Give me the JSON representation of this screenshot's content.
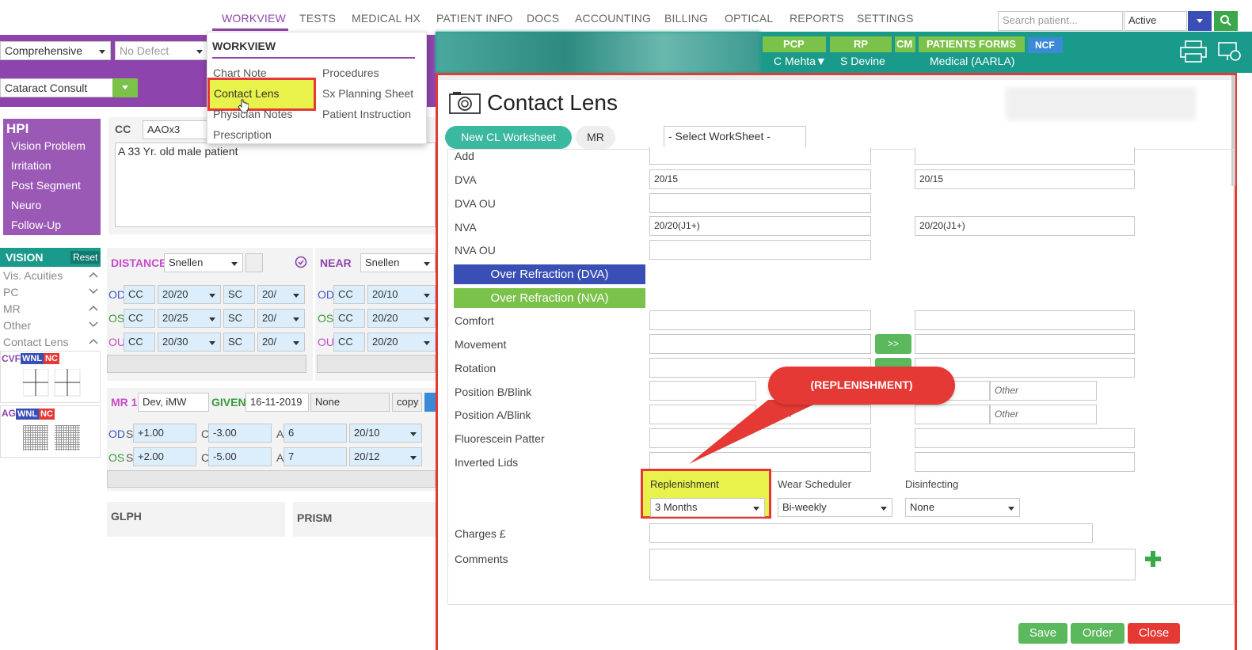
{
  "nav": {
    "tabs": [
      "WORKVIEW",
      "TESTS",
      "MEDICAL HX",
      "PATIENT INFO",
      "DOCS",
      "ACCOUNTING",
      "BILLING",
      "OPTICAL",
      "REPORTS",
      "SETTINGS"
    ],
    "search_placeholder": "Search patient...",
    "status": "Active"
  },
  "top": {
    "exam_type": "Comprehensive",
    "defect": "No Defect",
    "consult": "Cataract Consult"
  },
  "menu": {
    "title": "WORKVIEW",
    "col1": [
      "Chart Note",
      "Contact Lens",
      "Physician Notes",
      "Prescription"
    ],
    "col2": [
      "Procedures",
      "Sx Planning Sheet",
      "Patient Instruction"
    ]
  },
  "hpi": {
    "title": "HPI",
    "items": [
      "Vision Problem",
      "Irritation",
      "Post Segment",
      "Neuro",
      "Follow-Up"
    ],
    "cc_label": "CC",
    "cc_value": "AAOx3",
    "note": "A 33 Yr. old male patient"
  },
  "vision": {
    "title": "VISION",
    "reset": "Reset",
    "items": [
      "Vis. Acuities",
      "PC",
      "MR",
      "Other",
      "Contact Lens"
    ],
    "cvf": "CVF",
    "ag": "AG",
    "wnl": "WNL",
    "nc": "NC"
  },
  "distance": {
    "label": "DISTANCE",
    "chart": "Snellen",
    "rows": [
      {
        "eye": "OD",
        "cc": "CC",
        "v1": "20/20",
        "sc": "SC",
        "v2": "20/"
      },
      {
        "eye": "OS",
        "cc": "CC",
        "v1": "20/25",
        "sc": "SC",
        "v2": "20/"
      },
      {
        "eye": "OU",
        "cc": "CC",
        "v1": "20/30",
        "sc": "SC",
        "v2": "20/"
      }
    ]
  },
  "near": {
    "label": "NEAR",
    "chart": "Snellen",
    "rows": [
      {
        "eye": "OD",
        "cc": "CC",
        "v1": "20/10"
      },
      {
        "eye": "OS",
        "cc": "CC",
        "v1": "20/20"
      },
      {
        "eye": "OU",
        "cc": "CC",
        "v1": "20/20"
      }
    ]
  },
  "mr": {
    "label": "MR 1",
    "prov": "Dev, iMW",
    "given": "GIVEN",
    "date": "16-11-2019",
    "none": "None",
    "copy": "copy",
    "rows": [
      {
        "eye": "OD",
        "s": "+1.00",
        "c": "-3.00",
        "a": "6",
        "va": "20/10"
      },
      {
        "eye": "OS",
        "s": "+2.00",
        "c": "-5.00",
        "a": "7",
        "va": "20/12"
      }
    ]
  },
  "bottom": {
    "glph": "GLPH",
    "prism": "PRISM"
  },
  "header_right": {
    "pcp": "PCP",
    "pcp_name": "C Mehta▼",
    "rp": "RP",
    "rp_name": "S Devine",
    "cm": "CM",
    "forms": "PATIENTS FORMS",
    "forms_sub": "Medical (AARLA)",
    "ncf": "NCF"
  },
  "cl": {
    "title": "Contact Lens",
    "new_ws": "New CL Worksheet",
    "mr_tab": "MR",
    "select_ws": "- Select WorkSheet -",
    "rows": [
      "Add",
      "DVA",
      "DVA OU",
      "NVA",
      "NVA OU"
    ],
    "dva_r": "20/15",
    "dva_l": "20/15",
    "nva_r": "20/20(J1+)",
    "nva_l": "20/20(J1+)",
    "over_dva": "Over Refraction (DVA)",
    "over_nva": "Over Refraction (NVA)",
    "fit_rows": [
      "Comfort",
      "Movement",
      "Rotation",
      "Position B/Blink",
      "Position A/Blink",
      "Fluorescein Patter",
      "Inverted Lids"
    ],
    "arrow": ">>",
    "other": "Other",
    "repl_label": "Replenishment",
    "repl_value": "3 Months",
    "wear_label": "Wear Scheduler",
    "wear_value": "Bi-weekly",
    "dis_label": "Disinfecting",
    "dis_value": "None",
    "charges": "Charges £",
    "comments": "Comments",
    "save": "Save",
    "order": "Order",
    "close": "Close",
    "callout": "(REPLENISHMENT)"
  },
  "colors": {
    "accent": "#1a9a8a",
    "purple": "#8e44ad",
    "green": "#5cb85c",
    "red": "#e53935",
    "highlight": "#e8f24a",
    "callout": "#e53935"
  }
}
